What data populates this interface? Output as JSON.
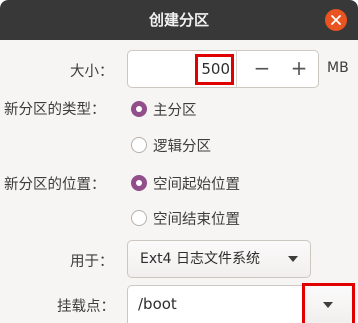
{
  "window": {
    "title": "创建分区"
  },
  "size": {
    "label": "大小：",
    "value": "500",
    "decrement": "−",
    "increment": "+",
    "unit": "MB"
  },
  "partition_type": {
    "label": "新分区的类型：",
    "options": [
      "主分区",
      "逻辑分区"
    ],
    "selected": "主分区"
  },
  "location": {
    "label": "新分区的位置：",
    "options": [
      "空间起始位置",
      "空间结束位置"
    ],
    "selected": "空间起始位置"
  },
  "use_as": {
    "label": "用于：",
    "selected": "Ext4 日志文件系统"
  },
  "mount_point": {
    "label": "挂载点：",
    "value": "/boot"
  },
  "colors": {
    "titlebar": "#383838",
    "close": "#e95420",
    "radio_selected": "#924d8b",
    "highlight": "#e00000"
  },
  "icons": {
    "close": "close-icon",
    "dropdown": "triangle-down-icon"
  }
}
